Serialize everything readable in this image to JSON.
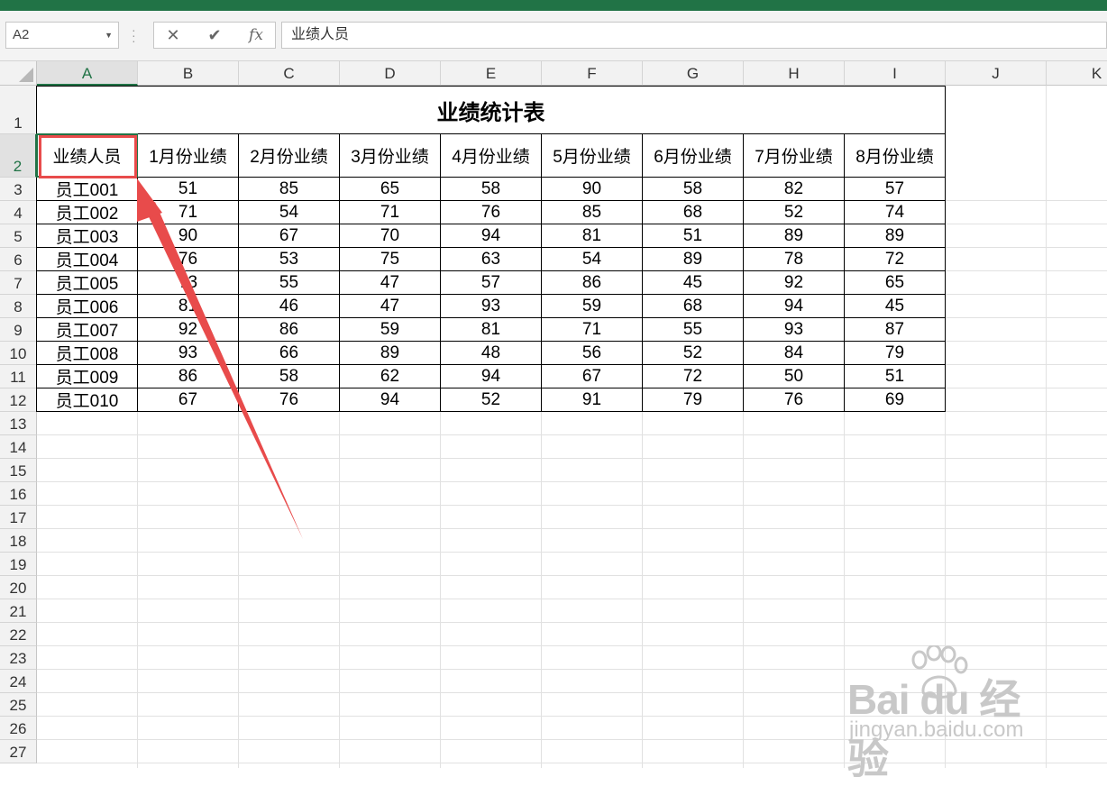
{
  "formula_bar": {
    "name_box": "A2",
    "cancel_glyph": "✕",
    "enter_glyph": "✔",
    "fx_label": "fx",
    "content": "业绩人员"
  },
  "columns": [
    "A",
    "B",
    "C",
    "D",
    "E",
    "F",
    "G",
    "H",
    "I",
    "J",
    "K"
  ],
  "rows": [
    "1",
    "2",
    "3",
    "4",
    "5",
    "6",
    "7",
    "8",
    "9",
    "10",
    "11",
    "12",
    "13",
    "14",
    "15",
    "16",
    "17",
    "18",
    "19",
    "20",
    "21",
    "22",
    "23",
    "24",
    "25",
    "26",
    "27"
  ],
  "sheet": {
    "title": "业绩统计表",
    "headers": [
      "业绩人员",
      "1月份业绩",
      "2月份业绩",
      "3月份业绩",
      "4月份业绩",
      "5月份业绩",
      "6月份业绩",
      "7月份业绩",
      "8月份业绩"
    ],
    "data": [
      [
        "员工001",
        "51",
        "85",
        "65",
        "58",
        "90",
        "58",
        "82",
        "57"
      ],
      [
        "员工002",
        "71",
        "54",
        "71",
        "76",
        "85",
        "68",
        "52",
        "74"
      ],
      [
        "员工003",
        "90",
        "67",
        "70",
        "94",
        "81",
        "51",
        "89",
        "89"
      ],
      [
        "员工004",
        "76",
        "53",
        "75",
        "63",
        "54",
        "89",
        "78",
        "72"
      ],
      [
        "员工005",
        "73",
        "55",
        "47",
        "57",
        "86",
        "45",
        "92",
        "65"
      ],
      [
        "员工006",
        "81",
        "46",
        "47",
        "93",
        "59",
        "68",
        "94",
        "45"
      ],
      [
        "员工007",
        "92",
        "86",
        "59",
        "81",
        "71",
        "55",
        "93",
        "87"
      ],
      [
        "员工008",
        "93",
        "66",
        "89",
        "48",
        "56",
        "52",
        "84",
        "79"
      ],
      [
        "员工009",
        "86",
        "58",
        "62",
        "94",
        "67",
        "72",
        "50",
        "51"
      ],
      [
        "员工010",
        "67",
        "76",
        "94",
        "52",
        "91",
        "79",
        "76",
        "69"
      ]
    ]
  },
  "selected_cell": "A2",
  "annotation_color": "#e84b4b",
  "watermark": {
    "main": "Bai du 经验",
    "sub": "jingyan.baidu.com"
  },
  "colors": {
    "excel_green": "#217346",
    "header_bg": "#f2f2f2"
  }
}
